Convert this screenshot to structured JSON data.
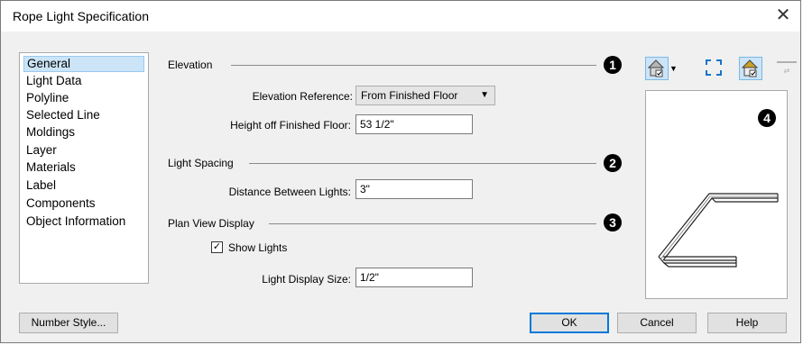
{
  "window": {
    "title": "Rope Light Specification",
    "close_icon": "close-icon"
  },
  "sidebar": {
    "items": [
      {
        "label": "General",
        "selected": true
      },
      {
        "label": "Light Data"
      },
      {
        "label": "Polyline"
      },
      {
        "label": "Selected Line"
      },
      {
        "label": "Moldings"
      },
      {
        "label": "Layer"
      },
      {
        "label": "Materials"
      },
      {
        "label": "Label"
      },
      {
        "label": "Components"
      },
      {
        "label": "Object Information"
      }
    ]
  },
  "elevation": {
    "heading": "Elevation",
    "callout": "1",
    "reference_label": "Elevation Reference:",
    "reference_value": "From Finished Floor",
    "height_label": "Height off Finished Floor:",
    "height_value": "53 1/2\""
  },
  "spacing": {
    "heading": "Light Spacing",
    "callout": "2",
    "distance_label": "Distance Between Lights:",
    "distance_value": "3\""
  },
  "plan": {
    "heading": "Plan View Display",
    "callout": "3",
    "show_lights_label": "Show Lights",
    "show_lights_checked": true,
    "size_label": "Light Display Size:",
    "size_value": "1/2\""
  },
  "preview": {
    "callout": "4"
  },
  "buttons": {
    "number_style": "Number Style...",
    "ok": "OK",
    "cancel": "Cancel",
    "help": "Help"
  },
  "colors": {
    "accent": "#0078d7",
    "selection": "#cce4f7"
  }
}
